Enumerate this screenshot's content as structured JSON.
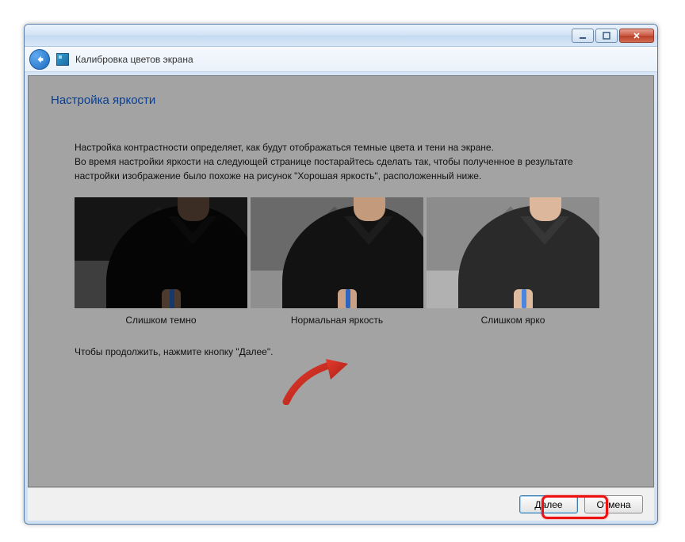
{
  "window": {
    "title": "Калибровка цветов экрана"
  },
  "page": {
    "heading": "Настройка яркости",
    "paragraph1": "Настройка контрастности определяет, как будут отображаться темные цвета и тени на экране.",
    "paragraph2": "Во время настройки яркости на следующей странице постарайтесь сделать так, чтобы полученное в результате настройки изображение было похоже на рисунок \"Хорошая яркость\", расположенный ниже.",
    "continue_text": "Чтобы продолжить, нажмите кнопку \"Далее\"."
  },
  "thumbnails": {
    "dark": "Слишком темно",
    "good": "Нормальная яркость",
    "bright": "Слишком ярко"
  },
  "footer": {
    "next": "Далее",
    "cancel": "Отмена"
  },
  "icons": {
    "minimize": "minimize",
    "maximize": "maximize",
    "close": "close",
    "back": "back"
  }
}
